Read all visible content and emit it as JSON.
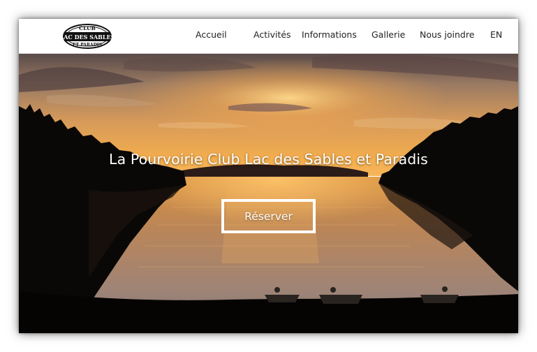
{
  "header": {
    "logo": {
      "line1": "CLUB",
      "line2": "LAC DES SABLES",
      "line3": "ET PARADIS"
    },
    "nav": {
      "accueil": "Accueil",
      "activites": "Activités",
      "informations": "Informations",
      "gallerie": "Gallerie",
      "contact": "Nous joindre",
      "language": "EN"
    }
  },
  "hero": {
    "title": "La Pourvoirie Club Lac des Sables et Paradis",
    "cta_label": "Réserver",
    "image": "sunset-lake-photo"
  },
  "colors": {
    "sky_top": "#5b4a48",
    "sky_glow": "#f1a64c",
    "water": "#c98a4c",
    "treeline": "#0a0805",
    "button_border": "#ffffff"
  }
}
